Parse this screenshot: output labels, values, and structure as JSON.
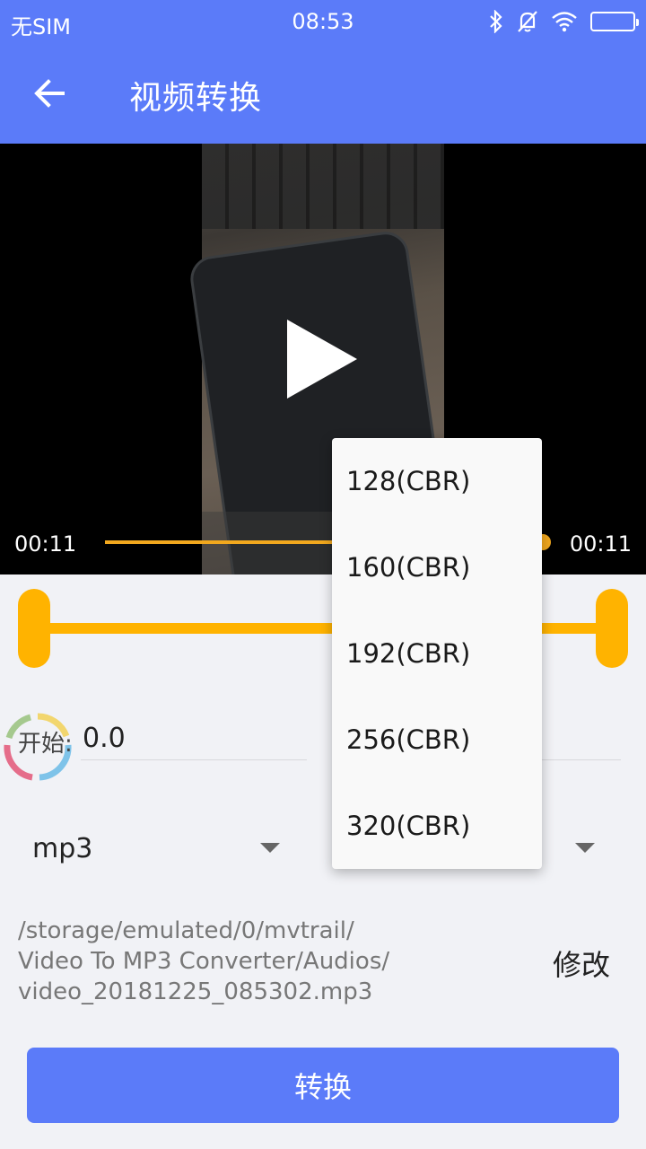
{
  "status_bar": {
    "carrier": "无SIM",
    "time": "08:53"
  },
  "app_bar": {
    "title": "视频转换"
  },
  "player": {
    "current_time": "00:11",
    "total_time": "00:11",
    "progress": 1.0
  },
  "trim": {
    "start_label": "开始:",
    "start_value": "0.0"
  },
  "format": {
    "selected": "mp3"
  },
  "output": {
    "path_lines": [
      "/storage/emulated/0/mvtrail/",
      "Video To MP3 Converter/Audios/",
      "video_20181225_085302.mp3"
    ],
    "modify_label": "修改"
  },
  "convert_label": "转换",
  "bitrate_menu": {
    "items": [
      "128(CBR)",
      "160(CBR)",
      "192(CBR)",
      "256(CBR)",
      "320(CBR)"
    ]
  },
  "colors": {
    "primary": "#5b7bf9",
    "accent": "#ffb300",
    "background": "#f1f2f6"
  },
  "icons": {
    "back": "arrow-left",
    "bluetooth": "bluetooth",
    "mute": "bell-off",
    "wifi": "wifi",
    "battery": "battery",
    "play": "play-triangle",
    "dropdown": "caret-down",
    "loading": "spinner-ring"
  }
}
